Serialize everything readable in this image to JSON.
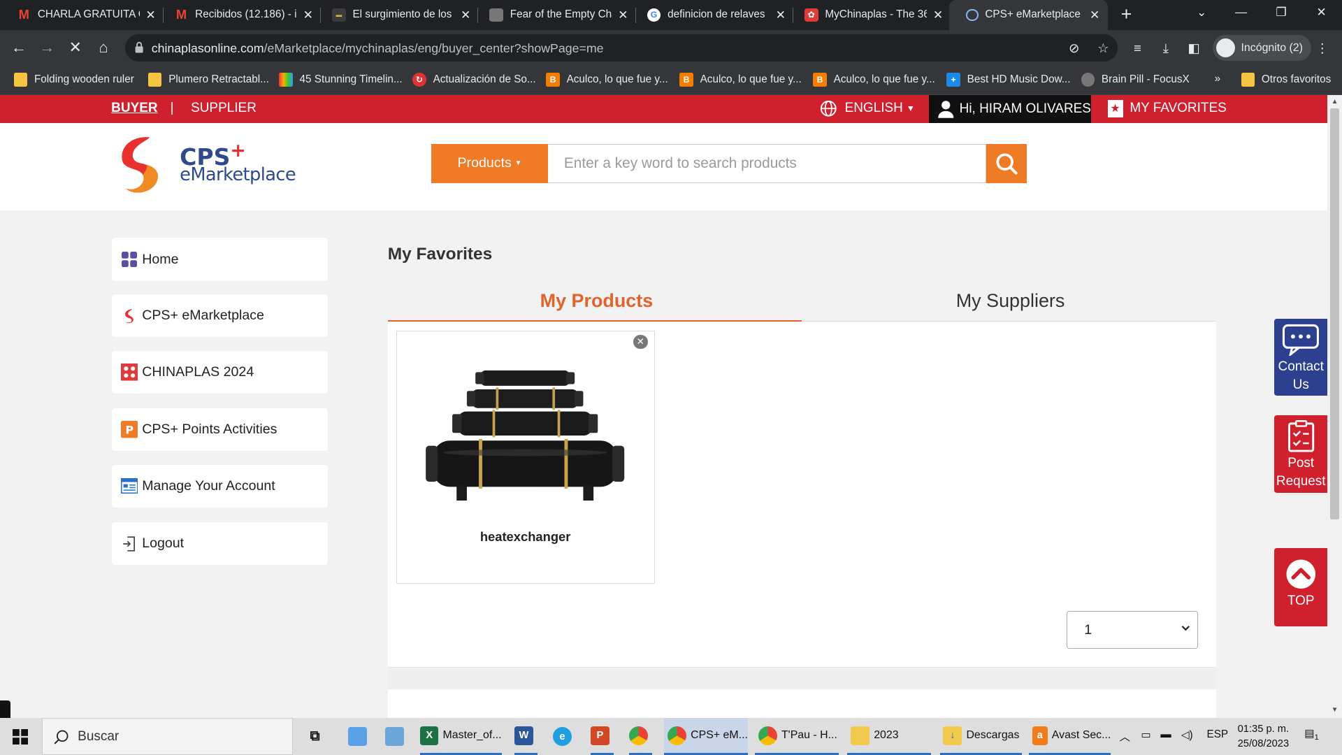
{
  "browser": {
    "tabs": [
      {
        "title": "CHARLA GRATUITA O",
        "icon": "gmail-icon"
      },
      {
        "title": "Recibidos (12.186) - in",
        "icon": "gmail-icon"
      },
      {
        "title": "El surgimiento de los",
        "icon": "site-icon"
      },
      {
        "title": "Fear of the Empty Cha",
        "icon": "site-icon"
      },
      {
        "title": "definicion de relaves",
        "icon": "google-icon"
      },
      {
        "title": "MyChinaplas - The 36",
        "icon": "chinaplas-icon"
      },
      {
        "title": "CPS+ eMarketplace",
        "icon": "loading-icon"
      }
    ],
    "url_domain": "chinaplasonline.com",
    "url_path": "/eMarketplace/mychinaplas/eng/buyer_center?showPage=me",
    "incognito_label": "Incógnito (2)",
    "bookmarks": [
      "Folding wooden ruler",
      "Plumero Retractabl...",
      "45 Stunning Timelin...",
      "Actualización de So...",
      "Aculco, lo que fue y...",
      "Aculco, lo que fue y...",
      "Aculco, lo que fue y...",
      "Best HD Music Dow...",
      "Brain Pill - FocusX"
    ],
    "bookmarks_overflow": "»",
    "other_bookmarks": "Otros favoritos"
  },
  "site": {
    "topbar": {
      "buyer": "BUYER",
      "separator": "|",
      "supplier": "SUPPLIER",
      "language": "ENGLISH",
      "user_greeting": "Hi, HIRAM OLIVARES",
      "favorites": "MY FAVORITES"
    },
    "logo": {
      "line1": "CPS",
      "plus": "+",
      "line2": "eMarketplace"
    },
    "search": {
      "category": "Products",
      "placeholder": "Enter a key word to search products"
    },
    "menu": [
      {
        "label": "Home",
        "icon": "grid-icon"
      },
      {
        "label": "CPS+ eMarketplace",
        "icon": "cps-logo-icon"
      },
      {
        "label": "CHINAPLAS 2024",
        "icon": "chinaplas-icon"
      },
      {
        "label": "CPS+ Points Activities",
        "icon": "points-icon"
      },
      {
        "label": "Manage Your Account",
        "icon": "account-icon"
      },
      {
        "label": "Logout",
        "icon": "logout-icon"
      }
    ],
    "favorites_title": "My Favorites",
    "content_tabs": {
      "products": "My Products",
      "suppliers": "My Suppliers"
    },
    "products": [
      {
        "name": "heatexchanger"
      }
    ],
    "pager_value": "1",
    "side_buttons": {
      "contact": [
        "Contact",
        "Us"
      ],
      "post": [
        "Post",
        "Request"
      ],
      "top": "TOP"
    },
    "colors": {
      "brand_red": "#d0202e",
      "accent_orange": "#ef7b27",
      "tab_orange": "#e2632b"
    }
  },
  "taskbar": {
    "search_placeholder": "Buscar",
    "apps": [
      {
        "label": "Master_of...",
        "icon": "excel-icon"
      },
      {
        "label": "CPS+ eM...",
        "icon": "chrome-icon"
      },
      {
        "label": "T'Pau - H...",
        "icon": "chrome-icon"
      },
      {
        "label": "2023",
        "icon": "folder-icon"
      },
      {
        "label": "Descargas",
        "icon": "downloads-folder-icon"
      },
      {
        "label": "Avast Sec...",
        "icon": "avast-icon"
      }
    ],
    "language": "ESP",
    "time": "01:35 p. m.",
    "date": "25/08/2023",
    "notifications": "1"
  }
}
